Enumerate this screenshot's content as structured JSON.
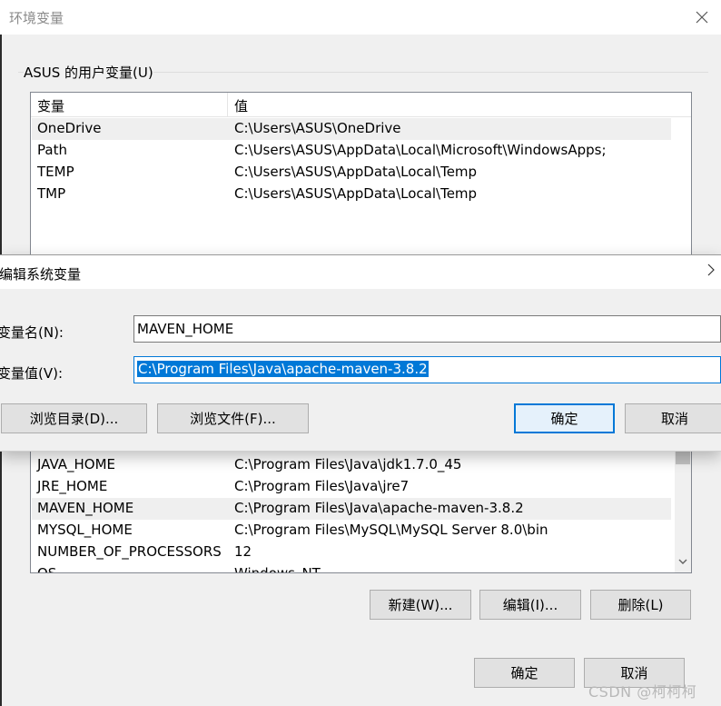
{
  "main_window": {
    "title": "环境变量",
    "user_group_label": "ASUS 的用户变量(U)",
    "columns": {
      "variable": "变量",
      "value": "值"
    },
    "user_vars": [
      {
        "name": "OneDrive",
        "value": "C:\\Users\\ASUS\\OneDrive"
      },
      {
        "name": "Path",
        "value": "C:\\Users\\ASUS\\AppData\\Local\\Microsoft\\WindowsApps;"
      },
      {
        "name": "TEMP",
        "value": "C:\\Users\\ASUS\\AppData\\Local\\Temp"
      },
      {
        "name": "TMP",
        "value": "C:\\Users\\ASUS\\AppData\\Local\\Temp"
      }
    ],
    "system_vars": [
      {
        "name": "JAVA_HOME",
        "value": "C:\\Program Files\\Java\\jdk1.7.0_45"
      },
      {
        "name": "JRE_HOME",
        "value": "C:\\Program Files\\Java\\jre7"
      },
      {
        "name": "MAVEN_HOME",
        "value": "C:\\Program Files\\Java\\apache-maven-3.8.2"
      },
      {
        "name": "MYSQL_HOME",
        "value": "C:\\Program Files\\MySQL\\MySQL Server 8.0\\bin"
      },
      {
        "name": "NUMBER_OF_PROCESSORS",
        "value": "12"
      },
      {
        "name": "OS",
        "value": "Windows_NT"
      }
    ],
    "system_buttons": {
      "new": "新建(W)...",
      "edit": "编辑(I)...",
      "delete": "删除(L)"
    },
    "ok": "确定",
    "cancel": "取消"
  },
  "edit_dialog": {
    "title": "编辑系统变量",
    "name_label": "变量名(N):",
    "name_value": "MAVEN_HOME",
    "value_label": "变量值(V):",
    "value_value": "C:\\Program Files\\Java\\apache-maven-3.8.2",
    "browse_dir": "浏览目录(D)...",
    "browse_file": "浏览文件(F)...",
    "ok": "确定",
    "cancel": "取消"
  },
  "watermark": "CSDN @柯柯柯",
  "colors": {
    "focus": "#0078d7",
    "selection": "#efefef"
  }
}
